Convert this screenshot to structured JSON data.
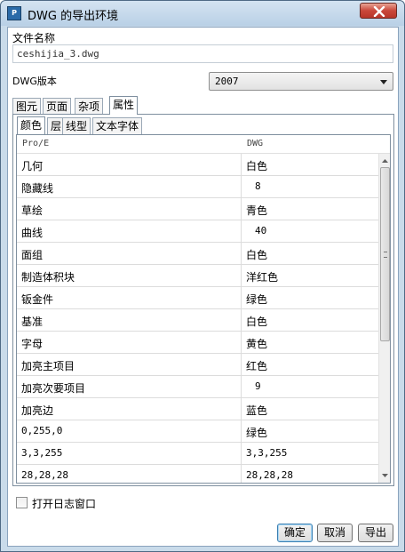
{
  "window": {
    "title": "DWG 的导出环境",
    "app_icon": "dwg-app-icon",
    "close_icon": "close-icon"
  },
  "file_name": {
    "label": "文件名称",
    "value": "ceshijia_3.dwg"
  },
  "version": {
    "label": "DWG版本",
    "selected": "2007"
  },
  "main_tabs": [
    {
      "label": "图元",
      "active": false
    },
    {
      "label": "页面",
      "active": false
    },
    {
      "label": "杂项",
      "active": false
    },
    {
      "label": "属性",
      "active": true
    }
  ],
  "sub_tabs": [
    {
      "label": "颜色",
      "active": true
    },
    {
      "label": "层",
      "active": false
    },
    {
      "label": "线型",
      "active": false
    },
    {
      "label": "文本字体",
      "active": false
    }
  ],
  "grid": {
    "headers": [
      "Pro/E",
      "DWG"
    ],
    "rows": [
      {
        "proe": "几何",
        "dwg": "白色"
      },
      {
        "proe": "隐藏线",
        "dwg": "8"
      },
      {
        "proe": "草绘",
        "dwg": "青色"
      },
      {
        "proe": "曲线",
        "dwg": "40"
      },
      {
        "proe": "面组",
        "dwg": "白色"
      },
      {
        "proe": "制造体积块",
        "dwg": "洋红色"
      },
      {
        "proe": "钣金件",
        "dwg": "绿色"
      },
      {
        "proe": "基准",
        "dwg": "白色"
      },
      {
        "proe": "字母",
        "dwg": "黄色"
      },
      {
        "proe": "加亮主项目",
        "dwg": "红色"
      },
      {
        "proe": "加亮次要项目",
        "dwg": "9"
      },
      {
        "proe": "加亮边",
        "dwg": "蓝色"
      },
      {
        "proe": "0,255,0",
        "dwg": "绿色"
      },
      {
        "proe": "3,3,255",
        "dwg": "3,3,255"
      },
      {
        "proe": "28,28,28",
        "dwg": "28,28,28"
      }
    ]
  },
  "log_window": {
    "label": "打开日志窗口",
    "checked": false
  },
  "buttons": {
    "ok": "确定",
    "cancel": "取消",
    "export": "导出"
  },
  "colors": {
    "title_bar": "#c9dbea",
    "close_button": "#c9473a",
    "default_button_border": "#3c7fb1"
  }
}
